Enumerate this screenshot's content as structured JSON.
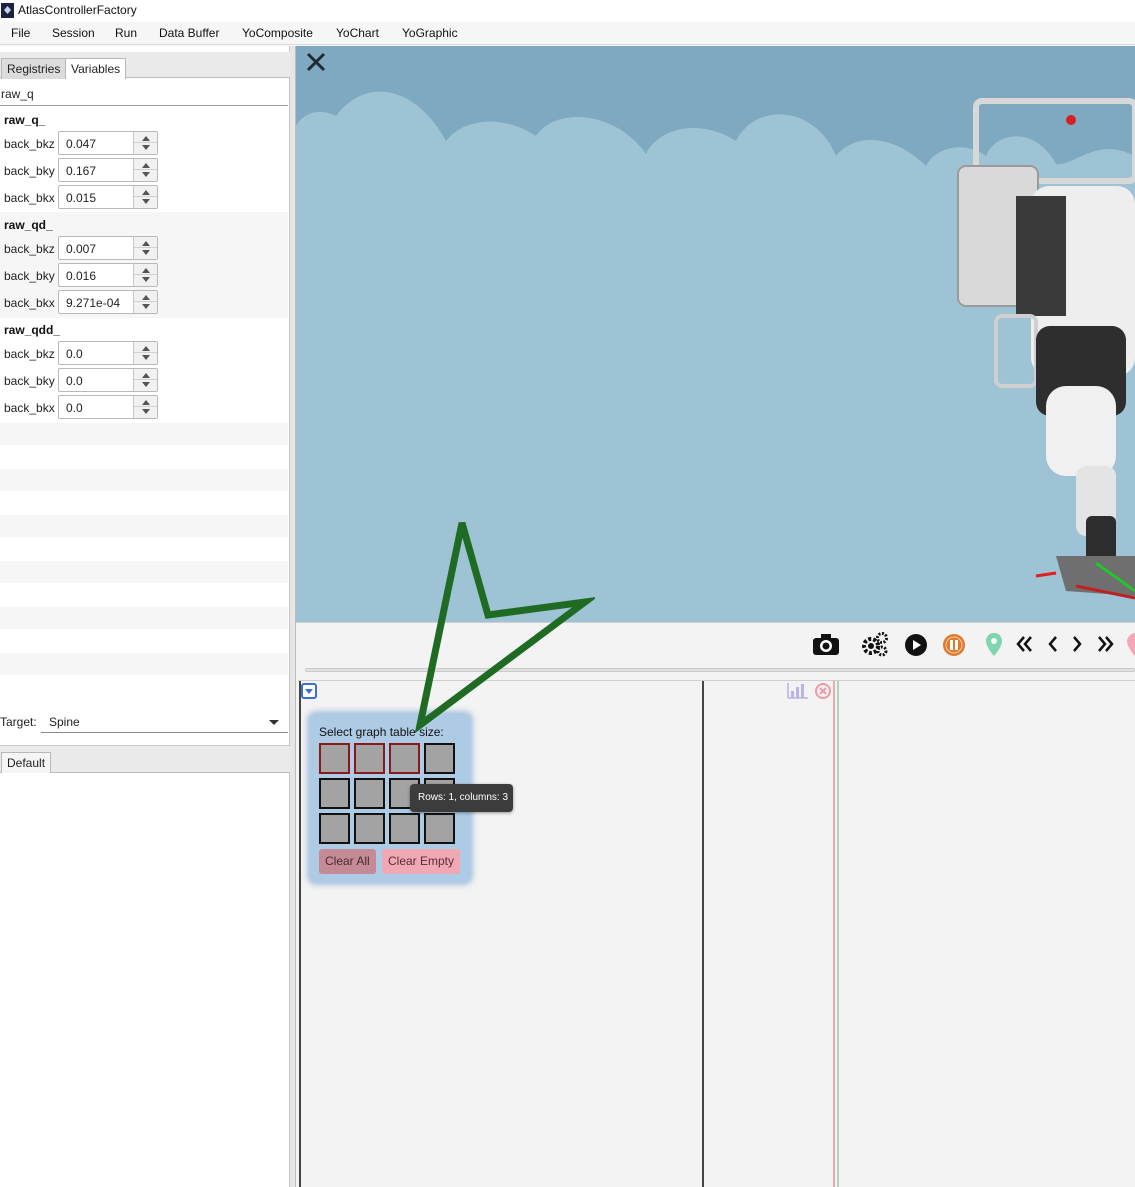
{
  "window": {
    "title": "AtlasControllerFactory"
  },
  "menu": [
    "File",
    "Session",
    "Run",
    "Data Buffer",
    "YoComposite",
    "YoChart",
    "YoGraphic"
  ],
  "left_tabs": [
    "Registries",
    "Variables"
  ],
  "search": {
    "value": "raw_q"
  },
  "groups": [
    {
      "header": "raw_q_",
      "vars": [
        {
          "name": "back_bkz",
          "value": "0.047"
        },
        {
          "name": "back_bky",
          "value": "0.167"
        },
        {
          "name": "back_bkx",
          "value": "0.015"
        }
      ]
    },
    {
      "header": "raw_qd_",
      "vars": [
        {
          "name": "back_bkz",
          "value": "0.007"
        },
        {
          "name": "back_bky",
          "value": "0.016"
        },
        {
          "name": "back_bkx",
          "value": "9.271e-04"
        }
      ]
    },
    {
      "header": "raw_qdd_",
      "vars": [
        {
          "name": "back_bkz",
          "value": "0.0"
        },
        {
          "name": "back_bky",
          "value": "0.0"
        },
        {
          "name": "back_bkx",
          "value": "0.0"
        }
      ]
    }
  ],
  "target": {
    "label": "Target:",
    "value": "Spine"
  },
  "bottom_tabs": [
    "Default"
  ],
  "graph_popup": {
    "title": "Select graph table size:",
    "clear_all": "Clear All",
    "clear_empty": "Clear Empty",
    "tooltip": "Rows: 1, columns: 3"
  },
  "colors": {
    "sky": "#9ec3d5",
    "arrow": "#1f6b24",
    "selected_cell_border": "#8a1a1a",
    "pause_button": "#e07a2e",
    "marker": "#7fd4b2"
  },
  "icons": [
    "close-icon",
    "camera-icon",
    "gears-icon",
    "play-icon",
    "pause-icon",
    "marker-icon",
    "rewind-icon",
    "step-back-icon",
    "step-forward-icon",
    "fast-forward-icon",
    "collapse-icon",
    "chart-icon",
    "close-chart-icon"
  ]
}
